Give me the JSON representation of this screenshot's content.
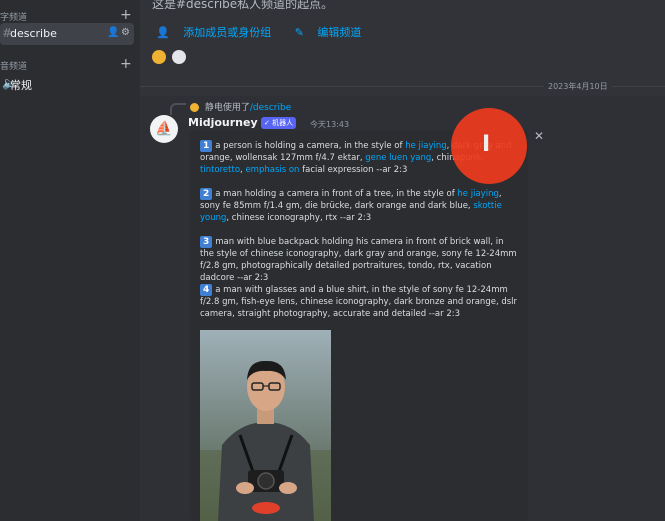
{
  "sidebar": {
    "text_category": "字频道",
    "channel": "describe",
    "voice_category": "音频道",
    "voice_channel": "常规"
  },
  "intro": {
    "text": "这是#describe私人频道的起点。",
    "add_members": "添加成员或身份组",
    "edit_channel": "编辑频道"
  },
  "date_divider": "2023年4月10日",
  "message": {
    "reply_user": "静电使用了",
    "reply_command": "/describe",
    "author": "Midjourney Bot",
    "badge": "✓ 机器人",
    "time": "今天13:43",
    "items": [
      {
        "num": "1",
        "pre": "a person is holding a camera, in the style of ",
        "l1": "he jiaying",
        "mid1": ", dark gray and orange, wollensak 127mm f/4.7 ektar, ",
        "l2": "gene luen yang",
        "mid2": ", chinapunk, ",
        "l3": "tintoretto",
        "mid3": ", ",
        "l4": "emphasis on",
        "post": " facial expression --ar 2:3"
      },
      {
        "num": "2",
        "pre": "a man holding a camera in front of a tree, in the style of ",
        "l1": "he jiaying",
        "mid1": ", sony fe 85mm f/1.4 gm, die brücke, dark orange and dark blue, ",
        "l2": "skottie young",
        "post": ", chinese iconography, rtx --ar 2:3"
      },
      {
        "num": "3",
        "text": "man with blue backpack holding his camera in front of brick wall, in the style of chinese iconography, dark gray and orange, sony fe 12-24mm f/2.8 gm, photographically detailed portraitures, tondo, rtx, vacation dadcore --ar 2:3"
      },
      {
        "num": "4",
        "text": "a man with glasses and a blue shirt, in the style of sony fe 12-24mm f/2.8 gm, fish-eye lens, chinese iconography, dark bronze and orange, dslr camera, straight photography, accurate and detailed --ar 2:3"
      }
    ]
  },
  "colors": {
    "accent_link": "#00a8fc",
    "bot_badge": "#5865f2",
    "number_box": "#3f7fd4",
    "cursor_highlight": "#ef3b1e"
  }
}
